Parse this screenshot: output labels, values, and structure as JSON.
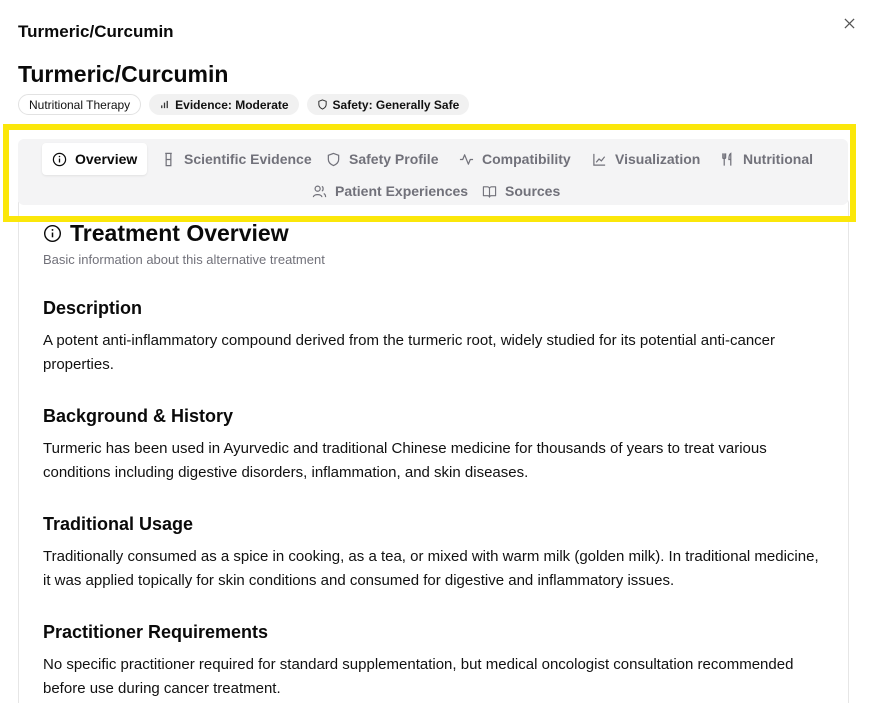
{
  "dialog": {
    "title": "Turmeric/Curcumin",
    "close_label": "×"
  },
  "treatment": {
    "name": "Turmeric/Curcumin",
    "badges": [
      {
        "label": "Nutritional Therapy",
        "icon": ""
      },
      {
        "label": "Evidence: Moderate",
        "icon": "bar-chart-icon"
      },
      {
        "label": "Safety: Generally Safe",
        "icon": "shield-icon"
      }
    ]
  },
  "tabs": [
    {
      "label": "Overview",
      "icon": "info-icon",
      "active": true
    },
    {
      "label": "Scientific Evidence",
      "icon": "flask-icon",
      "active": false
    },
    {
      "label": "Safety Profile",
      "icon": "shield-icon",
      "active": false
    },
    {
      "label": "Compatibility",
      "icon": "activity-icon",
      "active": false
    },
    {
      "label": "Visualization",
      "icon": "line-chart-icon",
      "active": false
    },
    {
      "label": "Nutritional",
      "icon": "utensils-icon",
      "active": false
    },
    {
      "label": "Patient Experiences",
      "icon": "users-icon",
      "active": false
    },
    {
      "label": "Sources",
      "icon": "book-icon",
      "active": false
    }
  ],
  "overview": {
    "title": "Treatment Overview",
    "subtitle": "Basic information about this alternative treatment",
    "sections": [
      {
        "heading": "Description",
        "text": "A potent anti-inflammatory compound derived from the turmeric root, widely studied for its potential anti-cancer properties."
      },
      {
        "heading": "Background & History",
        "text": "Turmeric has been used in Ayurvedic and traditional Chinese medicine for thousands of years to treat various conditions including digestive disorders, inflammation, and skin diseases."
      },
      {
        "heading": "Traditional Usage",
        "text": "Traditionally consumed as a spice in cooking, as a tea, or mixed with warm milk (golden milk). In traditional medicine, it was applied topically for skin conditions and consumed for digestive and inflammatory issues."
      },
      {
        "heading": "Practitioner Requirements",
        "text": "No specific practitioner required for standard supplementation, but medical oncologist consultation recommended before use during cancer treatment."
      }
    ]
  },
  "colors": {
    "highlight": "#fbe70a",
    "tab_bar_bg": "#f4f4f5",
    "muted_text": "#71717a"
  }
}
